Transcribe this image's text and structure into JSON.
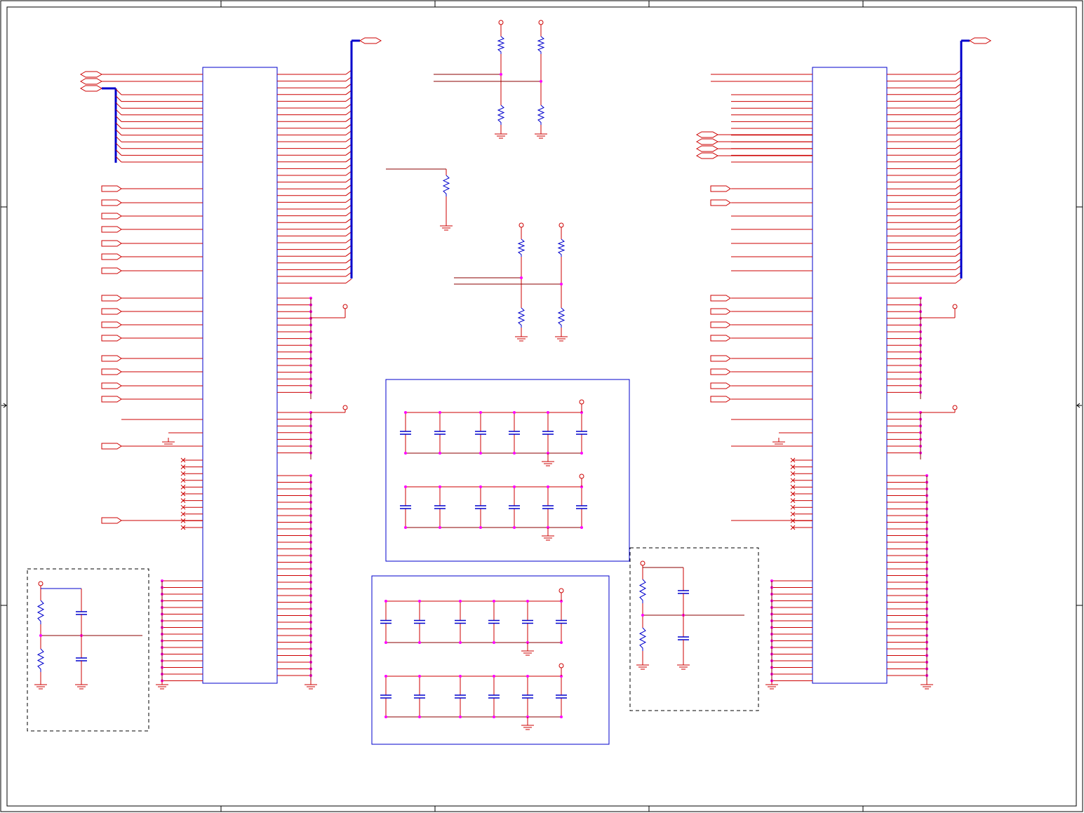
{
  "sheet": {
    "title": "",
    "border_color": "#000000"
  },
  "colors": {
    "net_wire": "#cc0000",
    "signal_wire": "#8b0000",
    "component": "#0000cc",
    "bus": "#0000cc",
    "junction": "#ff00ff",
    "dashed_group": "#000000"
  },
  "symbols": {
    "ic": "ic-package-outline",
    "resistor": "resistor-zigzag",
    "capacitor": "capacitor-plates",
    "ground": "ground-symbol",
    "power": "power-port-circle",
    "port": "port-arrow",
    "no_connect": "no-connect-x",
    "junction": "junction-dot"
  },
  "components": {
    "ic_count": 2,
    "decoupling_cap_blocks": 2,
    "caps_per_row": 6,
    "pullup_networks": 2,
    "divider_networks": 2
  }
}
